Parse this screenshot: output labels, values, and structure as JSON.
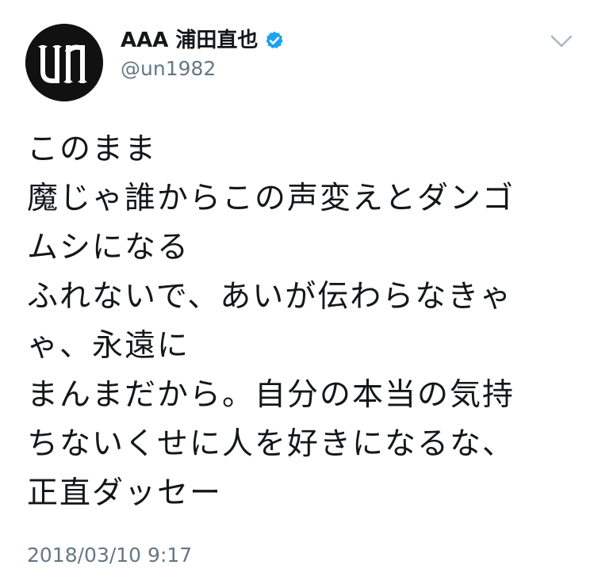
{
  "user": {
    "display_name": "AAA 浦田直也",
    "handle": "@un1982",
    "avatar_icon": "un-logo-icon",
    "verified_icon": "verified-badge-icon"
  },
  "menu": {
    "icon": "chevron-down-icon"
  },
  "tweet": {
    "lines": [
      "このまま",
      "魔じゃ誰からこの声変えとダンゴ",
      "ムシになる",
      "ふれないで、あいが伝わらなきゃ",
      "ゃ、永遠に",
      "まんまだから。自分の本当の気持",
      "ちないくせに人を好きになるな、",
      "正直ダッセー"
    ],
    "timestamp": "2018/03/10 9:17"
  },
  "colors": {
    "text": "#14171a",
    "secondary": "#657786",
    "verified": "#1da1f2",
    "avatar_bg": "#111111",
    "chevron": "#aab8c2"
  }
}
